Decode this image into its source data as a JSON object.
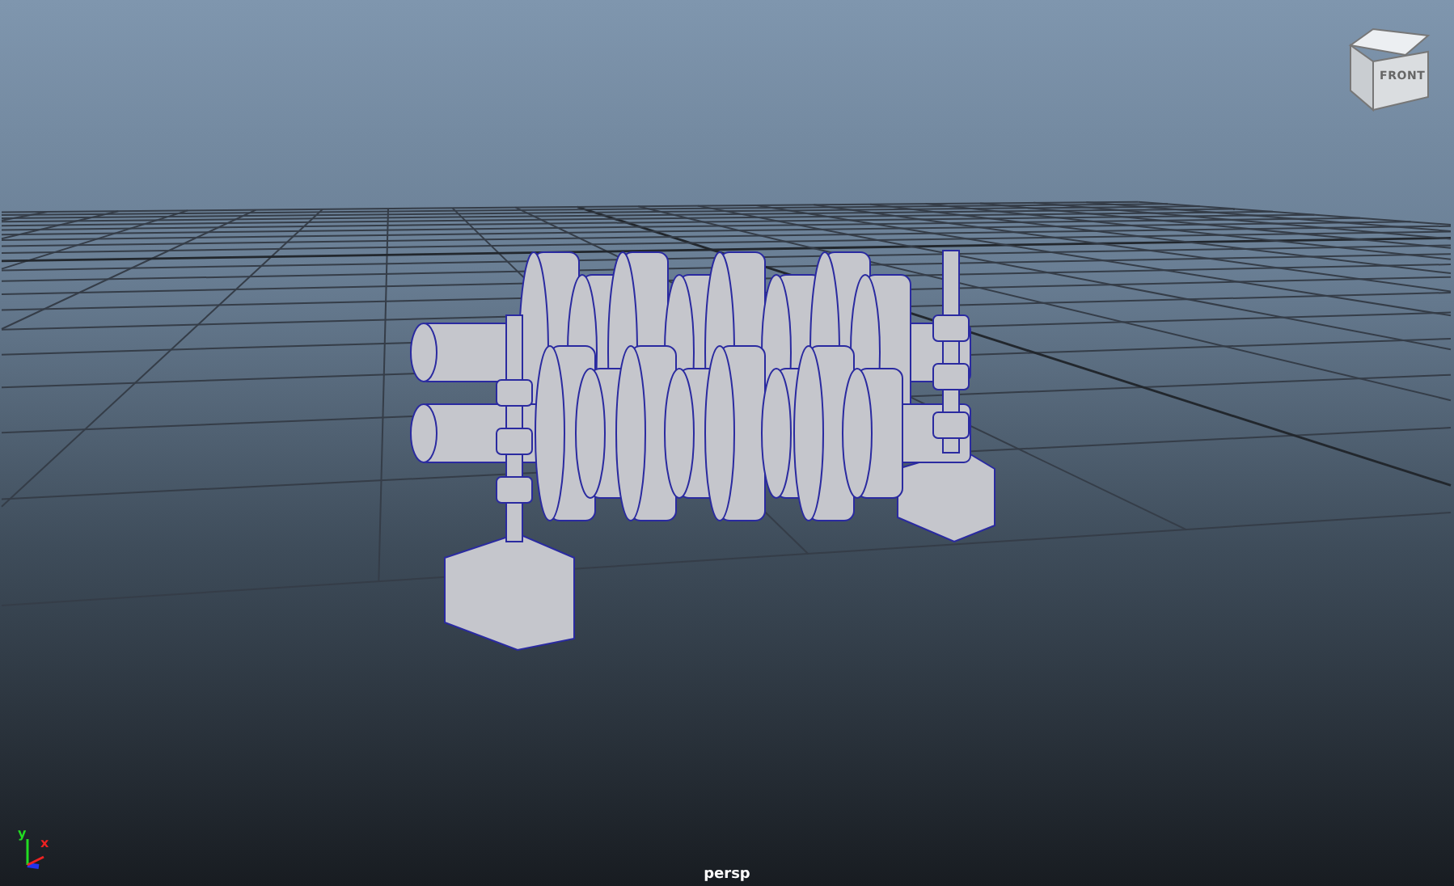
{
  "viewport": {
    "camera": "persp"
  },
  "view_cube": {
    "face_label": "FRONT"
  },
  "axis_gizmo": {
    "axes": [
      {
        "label": "y",
        "color": "#22dd22"
      },
      {
        "label": "x",
        "color": "#ee2222"
      }
    ]
  }
}
